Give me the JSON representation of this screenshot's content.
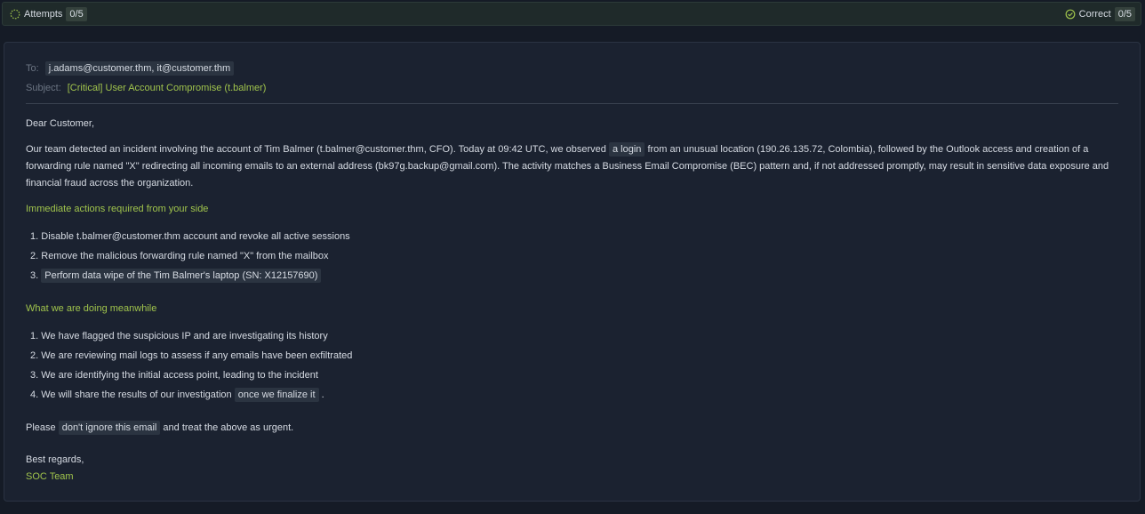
{
  "topbar": {
    "attempts_label": "Attempts",
    "attempts_count": "0/5",
    "correct_label": "Correct",
    "correct_count": "0/5"
  },
  "email": {
    "to_label": "To:",
    "to_value": "j.adams@customer.thm, it@customer.thm",
    "subject_label": "Subject:",
    "subject_value": "[Critical] User Account Compromise (t.balmer)",
    "greeting": "Dear Customer,",
    "para1": {
      "before": "Our team detected an incident involving the account of Tim Balmer (t.balmer@customer.thm, CFO). Today at 09:42 UTC, we observed ",
      "highlight": "a login",
      "after": " from an unusual location (190.26.135.72, Colombia), followed by the Outlook access and creation of a forwarding rule named \"X\" redirecting all incoming emails to an external address (bk97g.backup@gmail.com). The activity matches a Business Email Compromise (BEC) pattern and, if not addressed promptly, may result in sensitive data exposure and financial fraud across the organization."
    },
    "actions_title": "Immediate actions required from your side",
    "actions": [
      {
        "num": "1.",
        "text": "Disable t.balmer@customer.thm account and revoke all active sessions"
      },
      {
        "num": "2.",
        "text": "Remove the malicious forwarding rule named \"X\" from the mailbox"
      },
      {
        "num": "3.",
        "text": "Perform data wipe of the Tim Balmer's laptop (SN: X12157690)"
      }
    ],
    "meanwhile_title": "What we are doing meanwhile",
    "meanwhile": [
      {
        "num": "1.",
        "text": "We have flagged the suspicious IP and are investigating its history"
      },
      {
        "num": "2.",
        "text": "We are reviewing mail logs to assess if any emails have been exfiltrated"
      },
      {
        "num": "3.",
        "text": "We are identifying the initial access point, leading to the incident"
      },
      {
        "num": "4.",
        "before": "We will share the results of our investigation ",
        "highlight": "once we finalize it",
        "after": " ."
      }
    ],
    "closing": {
      "before": "Please ",
      "highlight": "don't ignore this email",
      "after": " and treat the above as urgent."
    },
    "regards": "Best regards,",
    "signature": "SOC Team"
  },
  "icons": {
    "attempts": "spinner-icon",
    "correct": "check-circle-icon"
  },
  "colors": {
    "accent_green": "#a0c44c",
    "background": "#151b26",
    "card": "#1b2230"
  }
}
